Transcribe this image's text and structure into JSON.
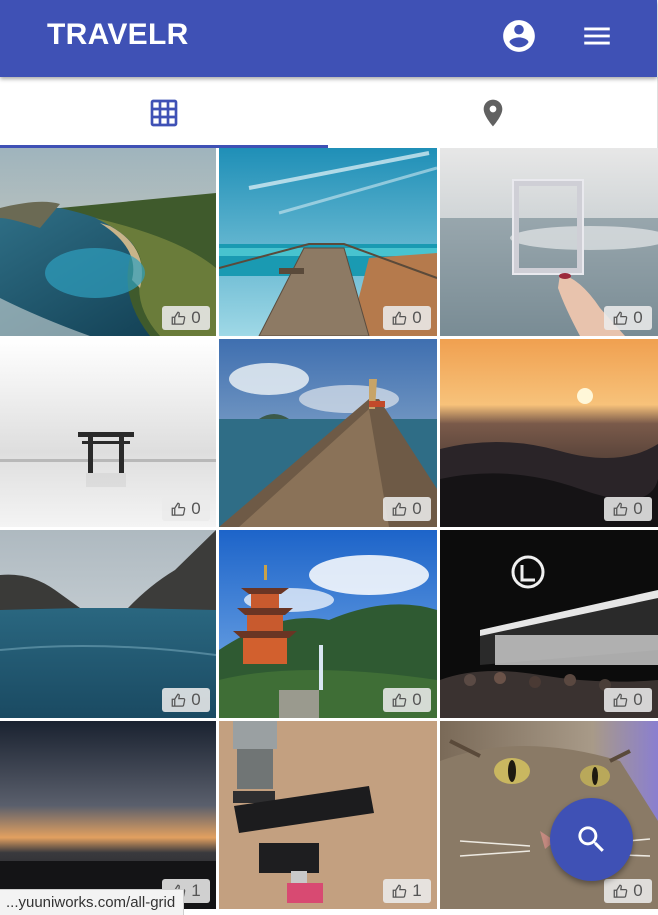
{
  "app": {
    "title": "TRAVELR"
  },
  "header": {
    "account_icon": "account-circle-icon",
    "menu_icon": "menu-icon"
  },
  "tabs": [
    {
      "name": "grid",
      "icon": "grid-icon",
      "active": true
    },
    {
      "name": "map",
      "icon": "location-pin-icon",
      "active": false
    }
  ],
  "photos": [
    {
      "scene": "coastal cliffs and bay",
      "likes": "0"
    },
    {
      "scene": "wooden pier over sea",
      "likes": "0"
    },
    {
      "scene": "hand holding empty polaroid frame at sea",
      "likes": "0"
    },
    {
      "scene": "torii gate in misty water",
      "likes": "0"
    },
    {
      "scene": "bow of wooden boat on sea",
      "likes": "0"
    },
    {
      "scene": "sunset over ocean waves",
      "likes": "0"
    },
    {
      "scene": "sea between rocky headlands",
      "likes": "0"
    },
    {
      "scene": "pagoda with waterfall",
      "likes": "0"
    },
    {
      "scene": "night building with crowd",
      "likes": "0"
    },
    {
      "scene": "dusk horizon",
      "likes": "1"
    },
    {
      "scene": "vape devices on table",
      "likes": "1"
    },
    {
      "scene": "close-up of tabby cat",
      "likes": "0"
    }
  ],
  "fab": {
    "icon": "search-icon"
  },
  "status_bar": {
    "url": "...yuuniworks.com/all-grid"
  },
  "colors": {
    "primary": "#3f51b5",
    "tab_inactive": "#616161",
    "on_primary": "#ffffff"
  }
}
